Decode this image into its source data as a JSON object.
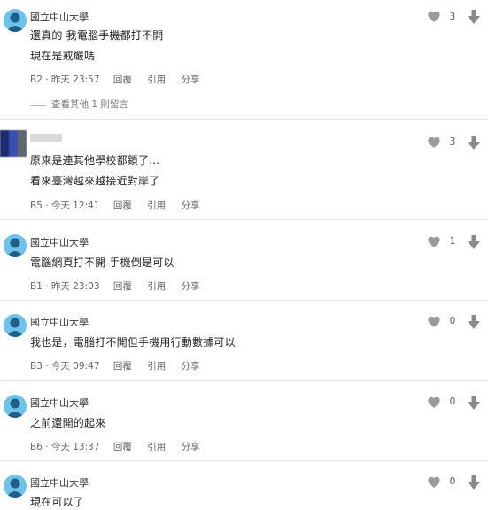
{
  "icons": {
    "heart": "heart-icon",
    "downvote": "arrow-down-icon"
  },
  "colors": {
    "avatar": "#6cc2ea",
    "icon_gray": "#9a9a9a",
    "divider": "#e6e6e6"
  },
  "actions": {
    "reply": "回覆",
    "quote": "引用",
    "share": "分享"
  },
  "comments": [
    {
      "author": "國立中山大學",
      "lines": [
        "還真的 我電腦手機都打不開",
        "現在是戒嚴嗎"
      ],
      "floor": "B2",
      "time": "昨天 23:57",
      "likes": "3",
      "more_replies": "查看其他 1 則留言"
    },
    {
      "author": "",
      "lines": [
        "原來是連其他學校都鎖了...",
        "看來臺灣越來越接近對岸了"
      ],
      "floor": "B5",
      "time": "今天 12:41",
      "likes": "3"
    },
    {
      "author": "國立中山大學",
      "lines": [
        "電腦網頁打不開 手機倒是可以"
      ],
      "floor": "B1",
      "time": "昨天 23:03",
      "likes": "1"
    },
    {
      "author": "國立中山大學",
      "lines": [
        "我也是，電腦打不開但手機用行動數據可以"
      ],
      "floor": "B3",
      "time": "今天 09:47",
      "likes": "0"
    },
    {
      "author": "國立中山大學",
      "lines": [
        "之前還開的起來"
      ],
      "floor": "B6",
      "time": "今天 13:37",
      "likes": "0"
    },
    {
      "author": "國立中山大學",
      "lines": [
        "現在可以了"
      ],
      "likes": "0"
    }
  ]
}
